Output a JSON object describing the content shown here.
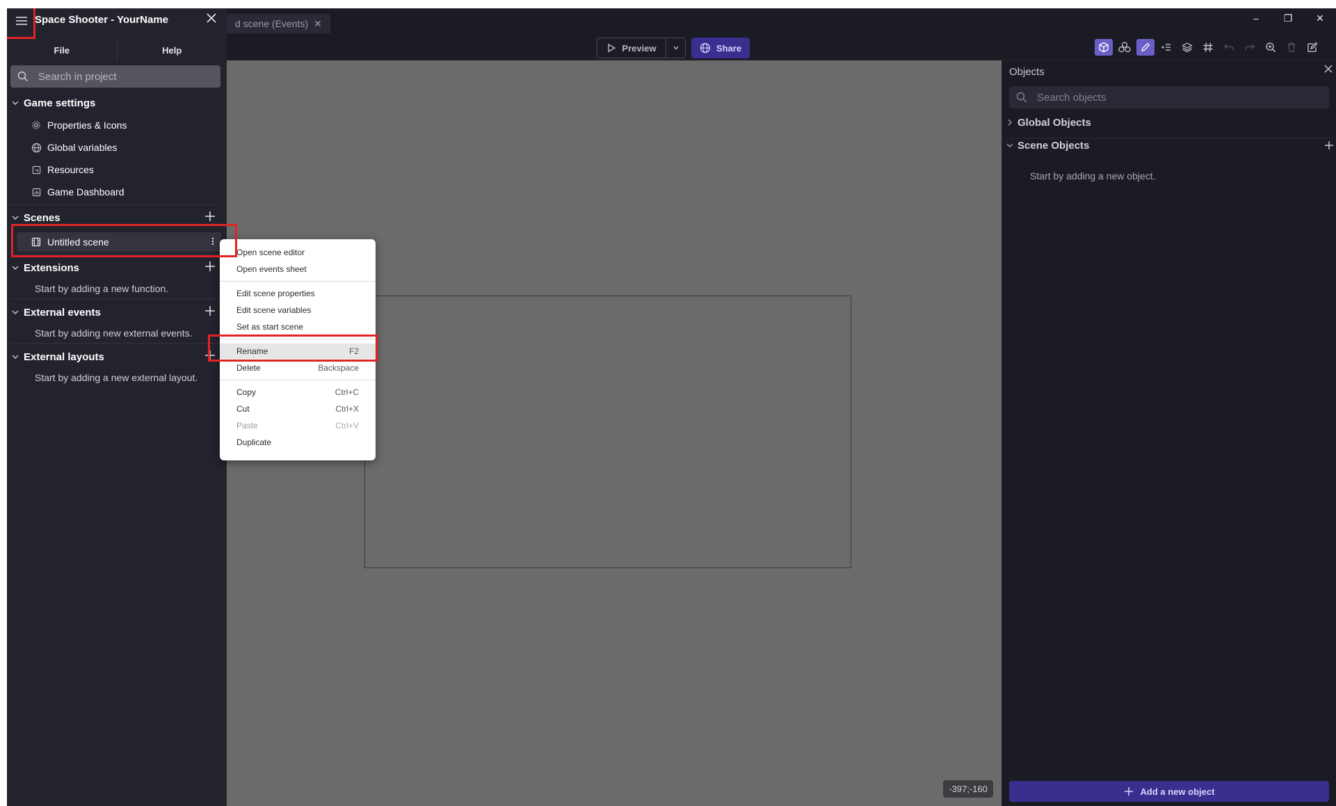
{
  "window": {
    "tab_label": "d scene (Events)",
    "minimize": "–",
    "restore": "❐",
    "close": "✕"
  },
  "toolbar": {
    "preview_label": "Preview",
    "share_label": "Share"
  },
  "drawer": {
    "title": "Space Shooter - YourName",
    "tabs": [
      "File",
      "Help"
    ],
    "search_placeholder": "Search in project",
    "game_settings": {
      "label": "Game settings",
      "items": [
        "Properties & Icons",
        "Global variables",
        "Resources",
        "Game Dashboard"
      ]
    },
    "scenes": {
      "label": "Scenes",
      "items": [
        "Untitled scene"
      ]
    },
    "extensions": {
      "label": "Extensions",
      "empty": "Start by adding a new function."
    },
    "external_events": {
      "label": "External events",
      "empty": "Start by adding new external events."
    },
    "external_layouts": {
      "label": "External layouts",
      "empty": "Start by adding a new external layout."
    }
  },
  "context_menu": {
    "open_scene_editor": "Open scene editor",
    "open_events_sheet": "Open events sheet",
    "edit_scene_properties": "Edit scene properties",
    "edit_scene_variables": "Edit scene variables",
    "set_as_start_scene": "Set as start scene",
    "rename": {
      "label": "Rename",
      "shortcut": "F2"
    },
    "delete": {
      "label": "Delete",
      "shortcut": "Backspace"
    },
    "copy": {
      "label": "Copy",
      "shortcut": "Ctrl+C"
    },
    "cut": {
      "label": "Cut",
      "shortcut": "Ctrl+X"
    },
    "paste": {
      "label": "Paste",
      "shortcut": "Ctrl+V"
    },
    "duplicate": "Duplicate"
  },
  "canvas": {
    "coordinates": "-397;-160"
  },
  "objects_panel": {
    "title": "Objects",
    "search_placeholder": "Search objects",
    "global_objects": "Global Objects",
    "scene_objects": "Scene Objects",
    "empty": "Start by adding a new object.",
    "add_button": "Add a new object"
  },
  "colors": {
    "accent": "#6b5fc7",
    "share_button": "#3a2f8f",
    "highlight_box": "#e02424"
  },
  "icons": {
    "hamburger": "menu-icon",
    "search": "search-icon",
    "settings": "gear-icon",
    "globe": "globe-icon",
    "resources": "resources-icon",
    "dashboard": "dashboard-icon",
    "scene": "film-icon",
    "more": "more-vertical-icon",
    "add": "plus-icon"
  }
}
